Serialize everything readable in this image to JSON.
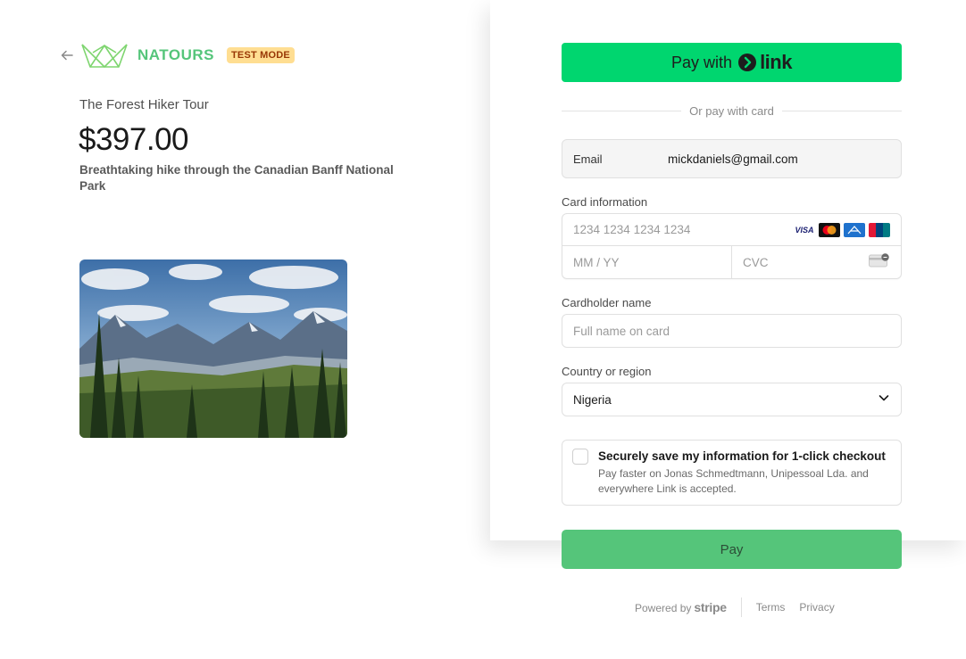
{
  "product": {
    "brand": "NATOURS",
    "badge": "TEST MODE",
    "name": "The Forest Hiker Tour",
    "price": "$397.00",
    "description": "Breathtaking hike through the Canadian Banff National Park"
  },
  "payment": {
    "link_button": {
      "prefix": "Pay with",
      "brand": "link"
    },
    "divider": "Or pay with card",
    "email": {
      "label": "Email",
      "value": "mickdaniels@gmail.com"
    },
    "card": {
      "label": "Card information",
      "number_placeholder": "1234 1234 1234 1234",
      "expiry_placeholder": "MM / YY",
      "cvc_placeholder": "CVC",
      "brands": [
        "visa-icon",
        "mastercard-icon",
        "amex-icon",
        "unionpay-icon"
      ]
    },
    "cardholder": {
      "label": "Cardholder name",
      "placeholder": "Full name on card"
    },
    "country": {
      "label": "Country or region",
      "value": "Nigeria"
    },
    "save": {
      "title": "Securely save my information for 1-click checkout",
      "subtitle": "Pay faster on Jonas Schmedtmann, Unipessoal Lda. and everywhere Link is accepted."
    },
    "pay_label": "Pay"
  },
  "footer": {
    "powered_by": "Powered by",
    "stripe": "stripe",
    "terms": "Terms",
    "privacy": "Privacy"
  },
  "colors": {
    "brand_green": "#55c57a",
    "link_green": "#00d66f",
    "badge_bg": "#ffde92",
    "badge_text": "#983705"
  }
}
